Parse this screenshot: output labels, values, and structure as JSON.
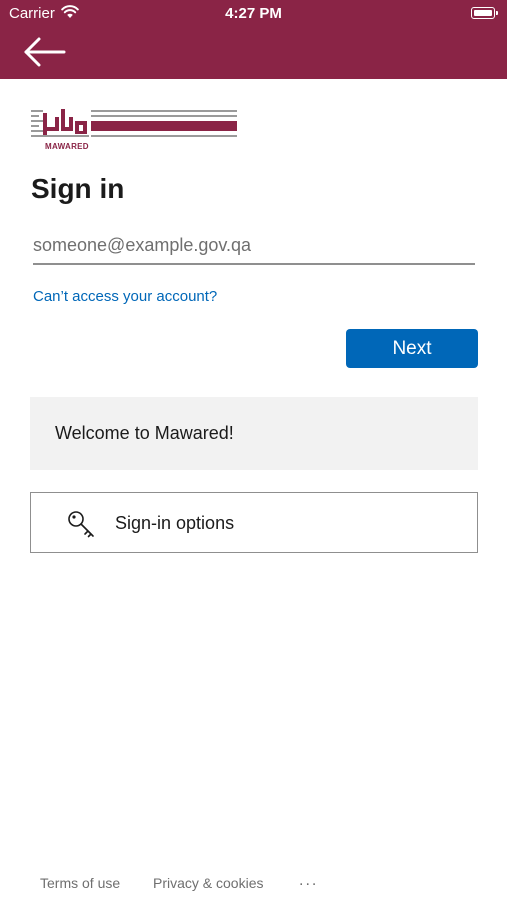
{
  "status_bar": {
    "carrier": "Carrier",
    "time": "4:27 PM"
  },
  "header": {
    "background_color": "#8a2446",
    "back_icon": "arrow-left-icon"
  },
  "logo": {
    "caption": "MAWARED",
    "brand_color": "#8a2446"
  },
  "signin": {
    "title": "Sign in",
    "email_placeholder": "someone@example.gov.qa",
    "email_value": "",
    "cant_access_link": "Can’t access your account?",
    "next_button": "Next",
    "accent_color": "#0067b8"
  },
  "welcome": {
    "text": "Welcome to Mawared!"
  },
  "signin_options": {
    "label": "Sign-in options",
    "icon": "key-icon"
  },
  "footer": {
    "terms": "Terms of use",
    "privacy": "Privacy & cookies",
    "more": "..."
  }
}
